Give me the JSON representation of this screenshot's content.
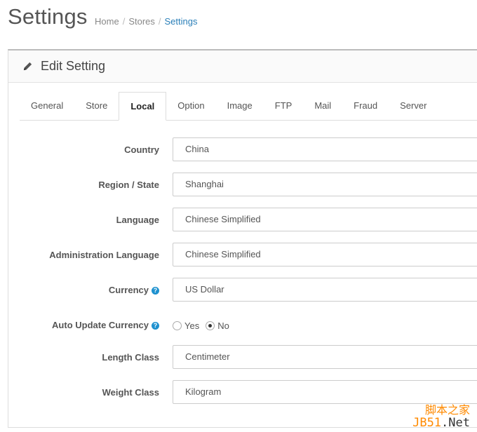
{
  "header": {
    "title": "Settings",
    "breadcrumb": [
      {
        "label": "Home"
      },
      {
        "label": "Stores"
      },
      {
        "label": "Settings"
      }
    ]
  },
  "panel": {
    "title": "Edit Setting",
    "icon": "pencil-icon"
  },
  "tabs": [
    "General",
    "Store",
    "Local",
    "Option",
    "Image",
    "FTP",
    "Mail",
    "Fraud",
    "Server"
  ],
  "active_tab": "Local",
  "form": {
    "country": {
      "label": "Country",
      "value": "China"
    },
    "region": {
      "label": "Region / State",
      "value": "Shanghai"
    },
    "language": {
      "label": "Language",
      "value": "Chinese Simplified"
    },
    "admin_language": {
      "label": "Administration Language",
      "value": "Chinese Simplified"
    },
    "currency": {
      "label": "Currency",
      "value": "US Dollar",
      "help": "?"
    },
    "auto_update": {
      "label": "Auto Update Currency",
      "help": "?",
      "yes": "Yes",
      "no": "No",
      "selected": "No"
    },
    "length_class": {
      "label": "Length Class",
      "value": "Centimeter"
    },
    "weight_class": {
      "label": "Weight Class",
      "value": "Kilogram"
    }
  },
  "watermark": {
    "line1": "脚本之家",
    "line2a": "JB51",
    "line2b": ".Net"
  },
  "colors": {
    "link": "#2a7fb8",
    "help_badge": "#1e91cf",
    "watermark": "#ff8a00"
  }
}
